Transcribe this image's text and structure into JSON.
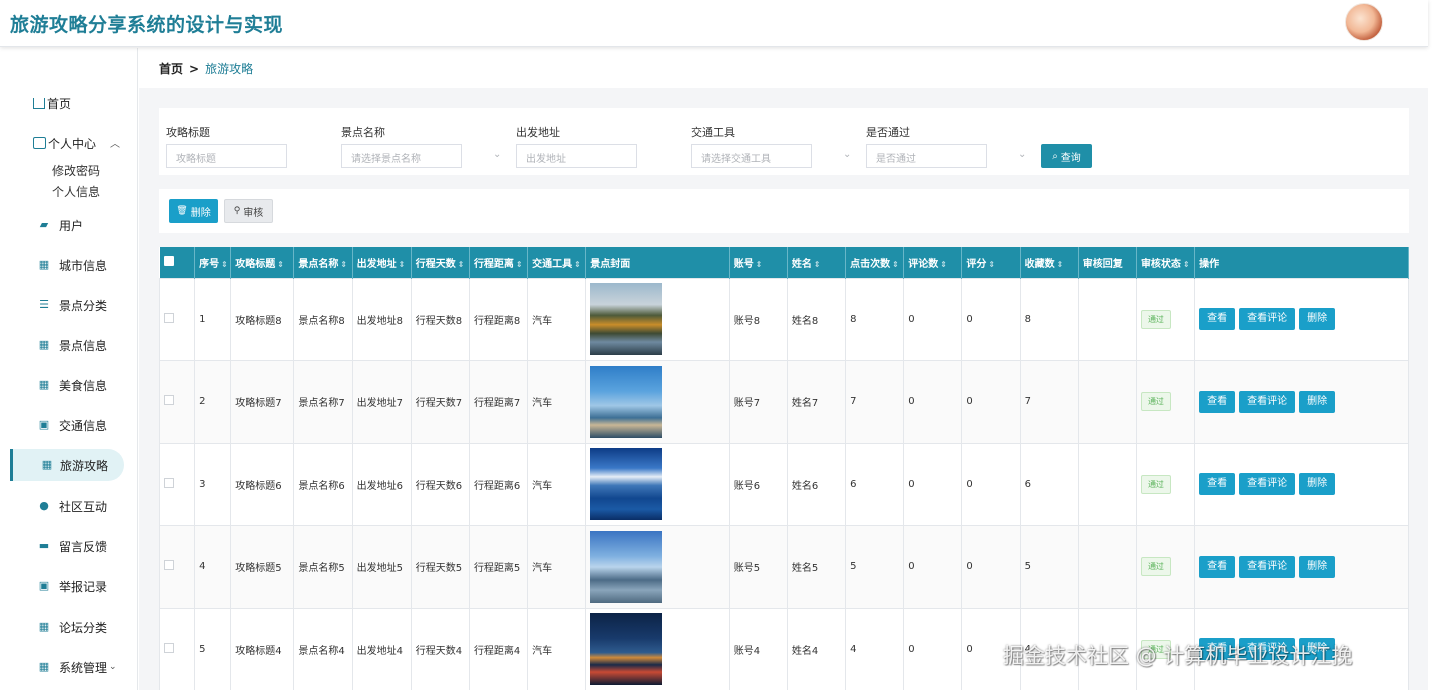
{
  "app": {
    "title": "旅游攻略分享系统的设计与实现"
  },
  "sidebar": {
    "home": "首页",
    "personal": {
      "label": "个人中心",
      "children": [
        "修改密码",
        "个人信息"
      ]
    },
    "items": [
      {
        "label": "用户",
        "icon": "user-icon"
      },
      {
        "label": "城市信息",
        "icon": "grid-icon"
      },
      {
        "label": "景点分类",
        "icon": "sliders-icon"
      },
      {
        "label": "景点信息",
        "icon": "grid-icon"
      },
      {
        "label": "美食信息",
        "icon": "grid-icon"
      },
      {
        "label": "交通信息",
        "icon": "clipboard-icon"
      },
      {
        "label": "旅游攻略",
        "icon": "grid-icon",
        "active": true
      },
      {
        "label": "社区互动",
        "icon": "pin-icon"
      },
      {
        "label": "留言反馈",
        "icon": "briefcase-icon"
      },
      {
        "label": "举报记录",
        "icon": "clipboard-icon"
      },
      {
        "label": "论坛分类",
        "icon": "grid-icon"
      },
      {
        "label": "系统管理",
        "icon": "grid-icon"
      }
    ]
  },
  "breadcrumb": {
    "home": "首页",
    "sep": ">",
    "current": "旅游攻略"
  },
  "filters": {
    "title": {
      "label": "攻略标题",
      "placeholder": "攻略标题"
    },
    "spot": {
      "label": "景点名称",
      "placeholder": "请选择景点名称"
    },
    "origin": {
      "label": "出发地址",
      "placeholder": "出发地址"
    },
    "transport": {
      "label": "交通工具",
      "placeholder": "请选择交通工具"
    },
    "approved": {
      "label": "是否通过",
      "placeholder": "是否通过"
    },
    "query_label": "查询"
  },
  "actions": {
    "delete_label": "删除",
    "audit_label": "审核"
  },
  "table": {
    "columns": [
      "序号",
      "攻略标题",
      "景点名称",
      "出发地址",
      "行程天数",
      "行程距离",
      "交通工具",
      "景点封面",
      "账号",
      "姓名",
      "点击次数",
      "评论数",
      "评分",
      "收藏数",
      "审核回复",
      "审核状态",
      "操作"
    ],
    "rows": [
      {
        "no": "1",
        "title": "攻略标题8",
        "spot": "景点名称8",
        "origin": "出发地址8",
        "days": "行程天数8",
        "distance": "行程距离8",
        "transport": "汽车",
        "account": "账号8",
        "name": "姓名8",
        "clicks": "8",
        "comments": "0",
        "score": "0",
        "favs": "8",
        "reply": "",
        "status": "通过"
      },
      {
        "no": "2",
        "title": "攻略标题7",
        "spot": "景点名称7",
        "origin": "出发地址7",
        "days": "行程天数7",
        "distance": "行程距离7",
        "transport": "汽车",
        "account": "账号7",
        "name": "姓名7",
        "clicks": "7",
        "comments": "0",
        "score": "0",
        "favs": "7",
        "reply": "",
        "status": "通过"
      },
      {
        "no": "3",
        "title": "攻略标题6",
        "spot": "景点名称6",
        "origin": "出发地址6",
        "days": "行程天数6",
        "distance": "行程距离6",
        "transport": "汽车",
        "account": "账号6",
        "name": "姓名6",
        "clicks": "6",
        "comments": "0",
        "score": "0",
        "favs": "6",
        "reply": "",
        "status": "通过"
      },
      {
        "no": "4",
        "title": "攻略标题5",
        "spot": "景点名称5",
        "origin": "出发地址5",
        "days": "行程天数5",
        "distance": "行程距离5",
        "transport": "汽车",
        "account": "账号5",
        "name": "姓名5",
        "clicks": "5",
        "comments": "0",
        "score": "0",
        "favs": "5",
        "reply": "",
        "status": "通过"
      },
      {
        "no": "5",
        "title": "攻略标题4",
        "spot": "景点名称4",
        "origin": "出发地址4",
        "days": "行程天数4",
        "distance": "行程距离4",
        "transport": "汽车",
        "account": "账号4",
        "name": "姓名4",
        "clicks": "4",
        "comments": "0",
        "score": "0",
        "favs": "4",
        "reply": "",
        "status": "通过"
      }
    ],
    "op_labels": {
      "view": "查看",
      "view_comments": "查看评论",
      "delete": "删除"
    }
  },
  "watermark": "掘金技术社区 @ 计算机毕业设计江挽",
  "colors": {
    "primary": "#1f8fa8",
    "button": "#1a9fc9",
    "title": "#1f7e96",
    "success": "#5bb35b"
  }
}
